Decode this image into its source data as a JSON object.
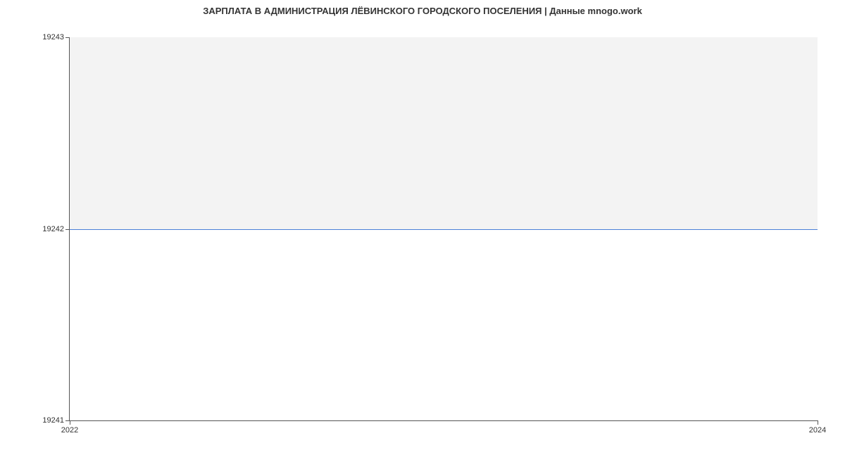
{
  "chart_data": {
    "type": "line",
    "title": "ЗАРПЛАТА В АДМИНИСТРАЦИЯ ЛЁВИНСКОГО ГОРОДСКОГО ПОСЕЛЕНИЯ | Данные mnogo.work",
    "x": [
      2022,
      2024
    ],
    "values": [
      19242,
      19242
    ],
    "xlabel": "",
    "ylabel": "",
    "xlim": [
      2022,
      2024
    ],
    "ylim": [
      19241,
      19243
    ],
    "x_ticks": [
      2022,
      2024
    ],
    "y_ticks": [
      19241,
      19242,
      19243
    ],
    "line_color": "#4a7fd8"
  }
}
